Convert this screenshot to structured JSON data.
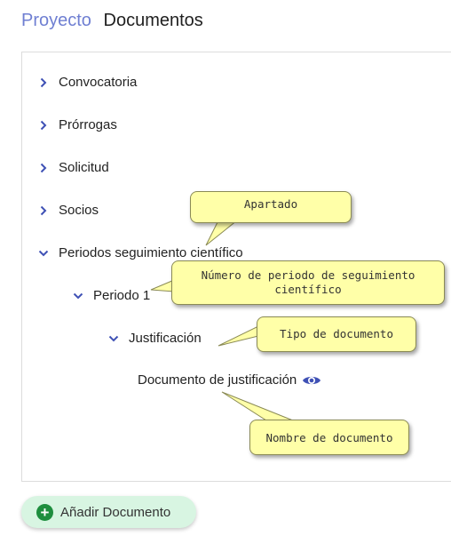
{
  "header": {
    "breadcrumb": "Proyecto",
    "title": "Documentos"
  },
  "tree": {
    "items": [
      {
        "label": "Convocatoria",
        "state": "collapsed"
      },
      {
        "label": "Prórrogas",
        "state": "collapsed"
      },
      {
        "label": "Solicitud",
        "state": "collapsed"
      },
      {
        "label": "Socios",
        "state": "collapsed"
      },
      {
        "label": "Periodos seguimiento científico",
        "state": "expanded"
      }
    ],
    "periodo": {
      "label": "Periodo 1",
      "state": "expanded"
    },
    "tipo": {
      "label": "Justificación",
      "state": "expanded"
    },
    "documento": {
      "label": "Documento de justificación",
      "icon": "eye-icon"
    }
  },
  "callouts": {
    "apartado": "Apartado",
    "numero_periodo": "Número de periodo de seguimiento científico",
    "tipo_documento": "Tipo de documento",
    "nombre_documento": "Nombre de documento"
  },
  "actions": {
    "add_label": "Añadir Documento",
    "add_icon": "plus-circle-icon"
  },
  "colors": {
    "accent": "#6f7fd2",
    "chevron": "#3f51b5",
    "callout_bg": "#ffffa8",
    "add_button_bg": "#d8f5e2",
    "add_icon_bg": "#1e8e3e"
  }
}
